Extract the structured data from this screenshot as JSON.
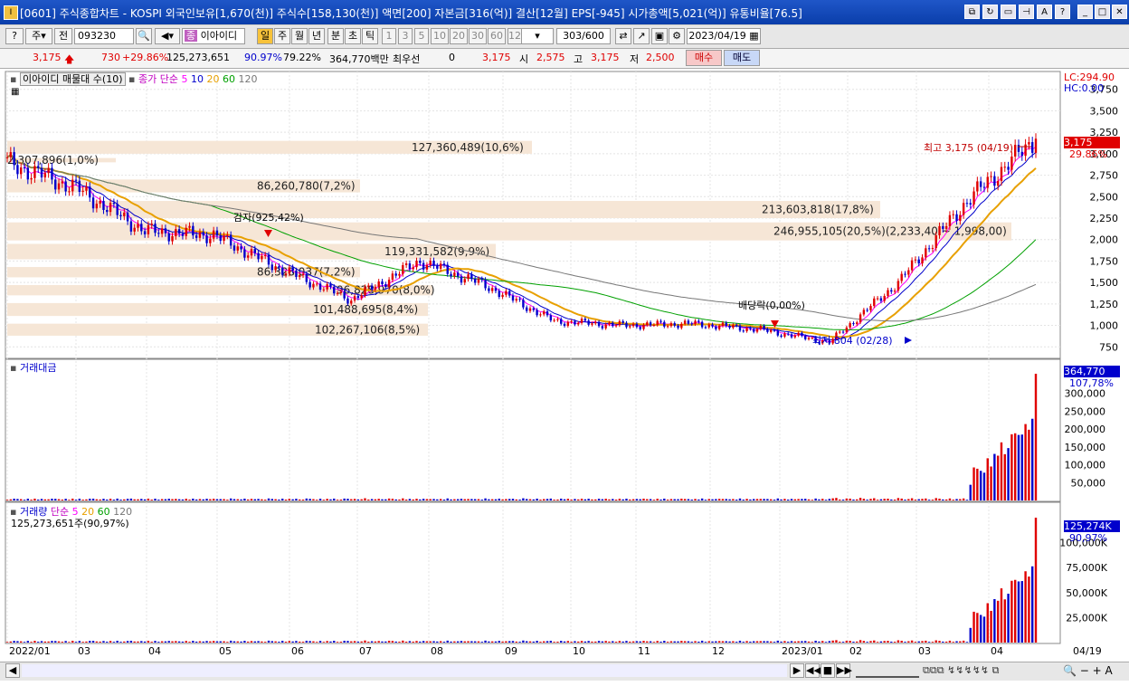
{
  "window": {
    "app_icon": "I",
    "title": "[0601] 주식종합차트 - KOSPI 외국인보유[1,670(천)] 주식수[158,130(천)] 액면[200] 자본금[316(억)] 결산[12월] EPS[-945] 시가총액[5,021(억)] 유통비율[76.5]"
  },
  "toolbar": {
    "market_select": "주",
    "jeon": "전",
    "code": "093230",
    "name": "이아이디",
    "period_day": "일",
    "period_week": "주",
    "period_month": "월",
    "period_year": "년",
    "period_min": "분",
    "period_sec": "초",
    "period_tick": "틱",
    "intervals": [
      "1",
      "3",
      "5",
      "10",
      "20",
      "30",
      "60",
      "120"
    ],
    "count": "303",
    "count_total": "/600",
    "date": "2023/04/19"
  },
  "quote": {
    "price": "3,175",
    "change": "730",
    "change_pct": "+29.86%",
    "volume": "125,273,651",
    "vol_ratio1": "90.97%",
    "vol_ratio2": "79.22%",
    "amount": "364,770백만",
    "best_bid_label": "최우선",
    "best_bid": "0",
    "best_price": "3,175",
    "open_label": "시",
    "open": "2,575",
    "high_label": "고",
    "high": "3,175",
    "low_label": "저",
    "low": "2,500",
    "buy": "매수",
    "sell": "매도"
  },
  "price_panel": {
    "legend_name": "이아이디 매물대 수(10)",
    "legend_ma_label": "종가 단순",
    "ma_periods": [
      "5",
      "10",
      "20",
      "60",
      "120"
    ],
    "ma_colors": [
      "#ff00ff",
      "#0000cc",
      "#e8a000",
      "#00a000",
      "#777777"
    ],
    "lc": "LC:294.90",
    "hc": "HC:0.00",
    "price_ticks": [
      "3,750",
      "3,500",
      "3,250",
      "3,000",
      "2,750",
      "2,500",
      "2,250",
      "2,000",
      "1,750",
      "1,500",
      "1,250",
      "1,000",
      "750"
    ],
    "last_price_box": "3,175",
    "last_pct": "29.86%",
    "high_note": "최고 3,175 (04/19)",
    "low_note": "최저 804 (02/28)",
    "gamja_note": "감자(925,42%)",
    "dividend_note": "배당락(0,00%)",
    "volume_profile": [
      {
        "text": "127,360,489(10,6%)"
      },
      {
        "text": "2,307,896(1,0%)"
      },
      {
        "text": "86,260,780(7,2%)"
      },
      {
        "text": "213,603,818(17,8%)"
      },
      {
        "text": "246,955,105(20,5%)(2,233,40 ~ 1,998,00)"
      },
      {
        "text": "119,331,582(9,9%)"
      },
      {
        "text": "86,328,037(7,2%)"
      },
      {
        "text": "96,828,970(8,0%)"
      },
      {
        "text": "101,488,695(8,4%)"
      },
      {
        "text": "102,267,106(8,5%)"
      }
    ]
  },
  "amount_panel": {
    "title": "거래대금",
    "last_box": "364,770",
    "last_pct": "107,78%",
    "ticks": [
      "300,000",
      "250,000",
      "200,000",
      "150,000",
      "100,000",
      "50,000"
    ]
  },
  "volume_panel": {
    "title": "거래량",
    "ma_label": "단순",
    "ma_periods": [
      "5",
      "20",
      "60",
      "120"
    ],
    "ma_colors": [
      "#ff00ff",
      "#e8a000",
      "#00a000",
      "#777777"
    ],
    "value_text": "125,273,651주(90,97%)",
    "last_box": "125,274K",
    "last_pct": "90,97%",
    "ticks": [
      "100,000K",
      "75,000K",
      "50,000K",
      "25,000K"
    ]
  },
  "date_axis": {
    "labels": [
      "2022/01",
      "03",
      "04",
      "05",
      "06",
      "07",
      "08",
      "09",
      "10",
      "11",
      "12",
      "2023/01",
      "02",
      "03",
      "04"
    ],
    "right_label": "04/19"
  },
  "chart_data": {
    "type": "candlestick",
    "x": [
      "2022/01",
      "03",
      "04",
      "05",
      "06",
      "07",
      "08",
      "09",
      "10",
      "11",
      "12",
      "2023/01",
      "02",
      "03",
      "04",
      "04/19"
    ],
    "close": [
      2900,
      2600,
      2100,
      2050,
      1650,
      1300,
      1750,
      1450,
      1050,
      1000,
      1020,
      950,
      804,
      1500,
      2450,
      3175
    ],
    "ylim": [
      700,
      3800
    ],
    "amount_ylim": [
      0,
      360000
    ],
    "volume_ylim": [
      0,
      125000
    ]
  }
}
